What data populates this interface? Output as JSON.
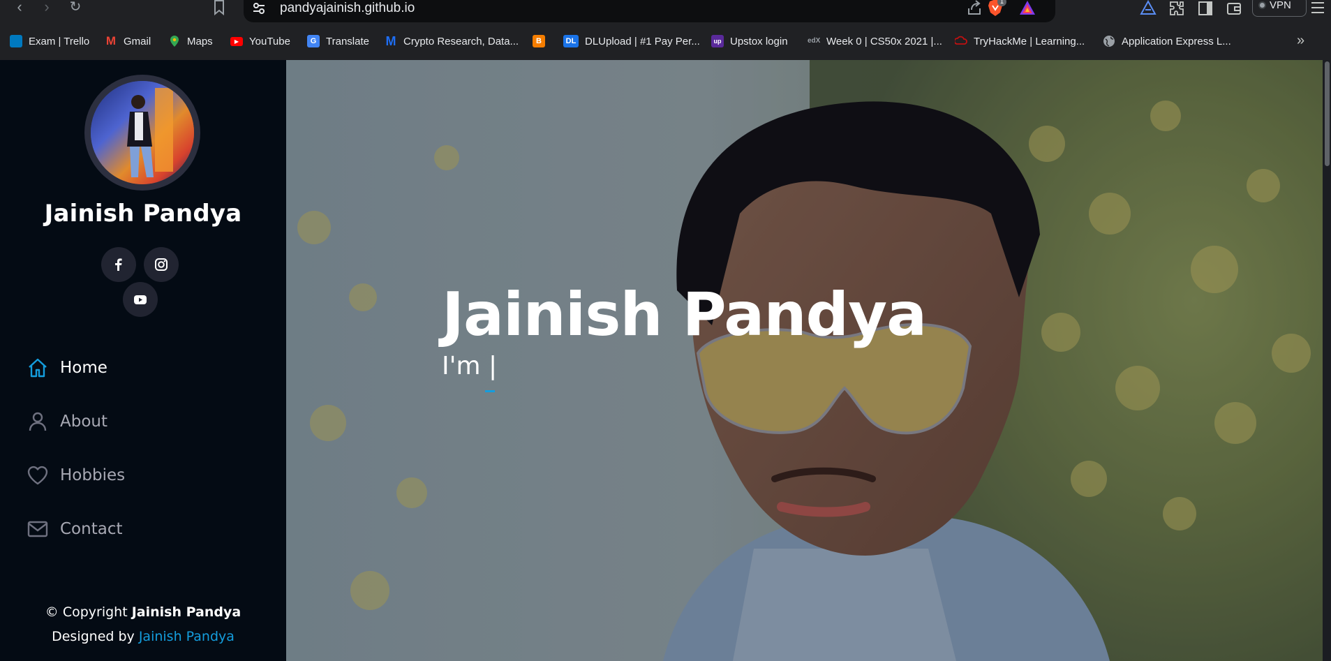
{
  "browser": {
    "url": "pandyajainish.github.io",
    "brave_badge_count": "1",
    "vpn_label": "VPN",
    "bookmarks": [
      {
        "label": "Exam | Trello",
        "icon": "trello-icon",
        "color": "#0079bf"
      },
      {
        "label": "Gmail",
        "icon": "gmail-icon",
        "color": "#ea4335"
      },
      {
        "label": "Maps",
        "icon": "maps-icon",
        "color": "#34a853"
      },
      {
        "label": "YouTube",
        "icon": "youtube-icon",
        "color": "#ff0000"
      },
      {
        "label": "Translate",
        "icon": "translate-icon",
        "color": "#4285f4"
      },
      {
        "label": "Crypto Research, Data...",
        "icon": "messari-icon",
        "color": "#1e6ef4"
      },
      {
        "label": "",
        "icon": "blogger-icon",
        "color": "#f57d00"
      },
      {
        "label": "DLUpload | #1 Pay Per...",
        "icon": "dlupload-icon",
        "color": "#1a73e8"
      },
      {
        "label": "Upstox login",
        "icon": "upstox-icon",
        "color": "#5a2a9b"
      },
      {
        "label": "Week 0 | CS50x 2021 |...",
        "icon": "edx-icon",
        "color": "#02262b"
      },
      {
        "label": "TryHackMe | Learning...",
        "icon": "tryhackme-icon",
        "color": "#c11111"
      },
      {
        "label": "Application Express L...",
        "icon": "globe-icon",
        "color": "#5f6368"
      }
    ]
  },
  "sidebar": {
    "name": "Jainish Pandya",
    "nav": [
      {
        "label": "Home",
        "icon": "home-icon"
      },
      {
        "label": "About",
        "icon": "user-icon"
      },
      {
        "label": "Hobbies",
        "icon": "heart-icon"
      },
      {
        "label": "Contact",
        "icon": "envelope-icon"
      }
    ],
    "copyright_prefix": "© Copyright ",
    "copyright_name": "Jainish Pandya",
    "designed_by_prefix": "Designed by ",
    "designed_by_name": "Jainish Pandya"
  },
  "hero": {
    "title": "Jainish Pandya",
    "subtitle": "I'm |"
  },
  "colors": {
    "accent": "#149ddd",
    "sidebar_bg": "#040b14",
    "social_bg": "#212431"
  }
}
